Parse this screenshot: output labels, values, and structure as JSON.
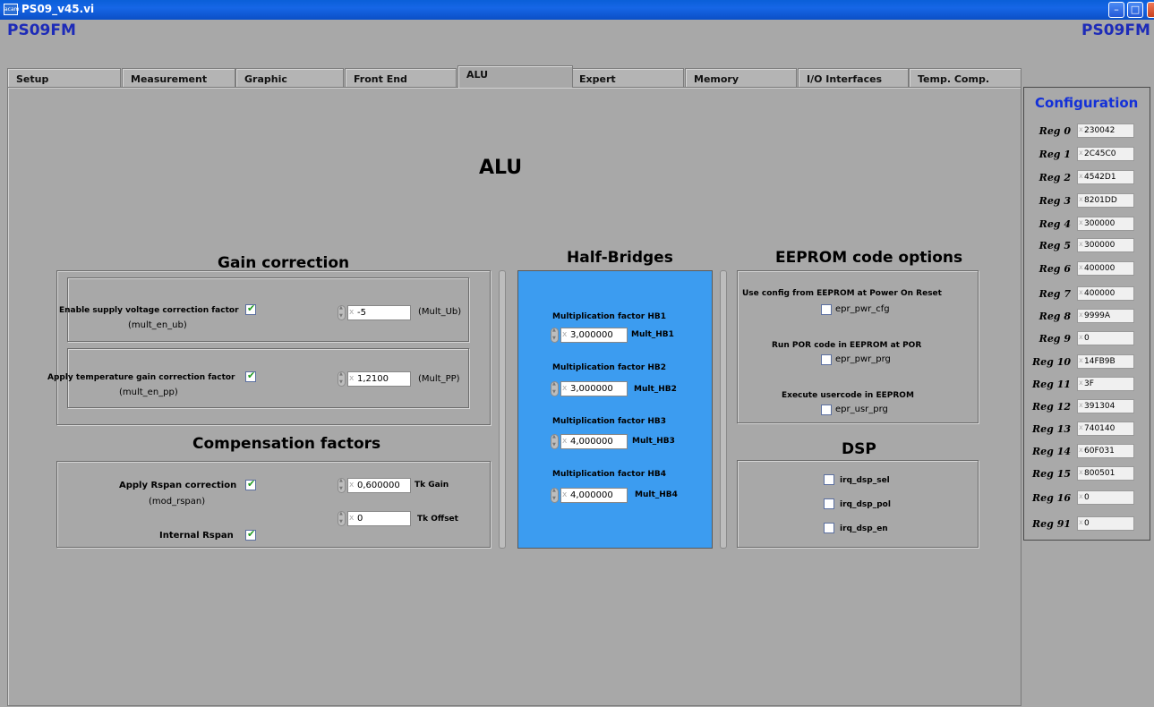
{
  "window": {
    "title": "PS09_v45.vi",
    "icon_text": "acam"
  },
  "brand": {
    "left": "PS09FM",
    "right": "PS09FM"
  },
  "tabs": [
    "Setup",
    "Measurement",
    "Graphic",
    "Front End",
    "ALU",
    "Expert",
    "Memory",
    "I/O Interfaces",
    "Temp. Comp."
  ],
  "active_tab": "ALU",
  "page_title": "ALU",
  "gain": {
    "title": "Gain correction",
    "supply_label": "Enable supply voltage correction factor",
    "supply_sub": "(mult_en_ub)",
    "supply_checked": true,
    "supply_value": "-5",
    "supply_unit": "(Mult_Ub)",
    "temp_label": "Apply temperature gain correction factor",
    "temp_sub": "(mult_en_pp)",
    "temp_checked": true,
    "temp_value": "1,2100",
    "temp_unit": "(Mult_PP)"
  },
  "comp": {
    "title": "Compensation factors",
    "rspan_label": "Apply Rspan correction",
    "rspan_sub": "(mod_rspan)",
    "rspan_checked": true,
    "internal_label": "Internal Rspan",
    "internal_checked": true,
    "tk_gain_value": "0,600000",
    "tk_gain_label": "Tk Gain",
    "tk_offset_value": "0",
    "tk_offset_label": "Tk Offset"
  },
  "hb": {
    "title": "Half-Bridges",
    "items": [
      {
        "caption": "Multiplication factor HB1",
        "value": "3,000000",
        "name": "Mult_HB1"
      },
      {
        "caption": "Multiplication factor HB2",
        "value": "3,000000",
        "name": "Mult_HB2"
      },
      {
        "caption": "Multiplication factor HB3",
        "value": "4,000000",
        "name": "Mult_HB3"
      },
      {
        "caption": "Multiplication factor HB4",
        "value": "4,000000",
        "name": "Mult_HB4"
      }
    ]
  },
  "eeprom": {
    "title": "EEPROM code options",
    "items": [
      {
        "label": "Use config from EEPROM at Power On Reset",
        "check": "epr_pwr_cfg"
      },
      {
        "label": "Run POR code in EEPROM at POR",
        "check": "epr_pwr_prg"
      },
      {
        "label": "Execute usercode in EEPROM",
        "check": "epr_usr_prg"
      }
    ]
  },
  "dsp": {
    "title": "DSP",
    "items": [
      "irq_dsp_sel",
      "irq_dsp_pol",
      "irq_dsp_en"
    ]
  },
  "config": {
    "title": "Configuration",
    "regs": [
      {
        "label": "Reg 0",
        "value": "230042"
      },
      {
        "label": "Reg 1",
        "value": "2C45C0"
      },
      {
        "label": "Reg 2",
        "value": "4542D1"
      },
      {
        "label": "Reg 3",
        "value": "8201DD"
      },
      {
        "label": "Reg 4",
        "value": "300000"
      },
      {
        "label": "Reg 5",
        "value": "300000"
      },
      {
        "label": "Reg 6",
        "value": "400000"
      },
      {
        "label": "Reg 7",
        "value": "400000"
      },
      {
        "label": "Reg 8",
        "value": "9999A"
      },
      {
        "label": "Reg 9",
        "value": "0"
      },
      {
        "label": "Reg 10",
        "value": "14FB9B"
      },
      {
        "label": "Reg 11",
        "value": "3F"
      },
      {
        "label": "Reg 12",
        "value": "391304"
      },
      {
        "label": "Reg 13",
        "value": "740140"
      },
      {
        "label": "Reg 14",
        "value": "60F031"
      },
      {
        "label": "Reg 15",
        "value": "800501"
      },
      {
        "label": "Reg 16",
        "value": "0"
      },
      {
        "label": "Reg 91",
        "value": "0"
      }
    ]
  },
  "colors": {
    "title_bar": "#0b57d0",
    "brand": "#1d2bb8",
    "hb_panel": "#3c9cf0",
    "config_title": "#1330d8",
    "panel_bg": "#a8a8a8"
  }
}
